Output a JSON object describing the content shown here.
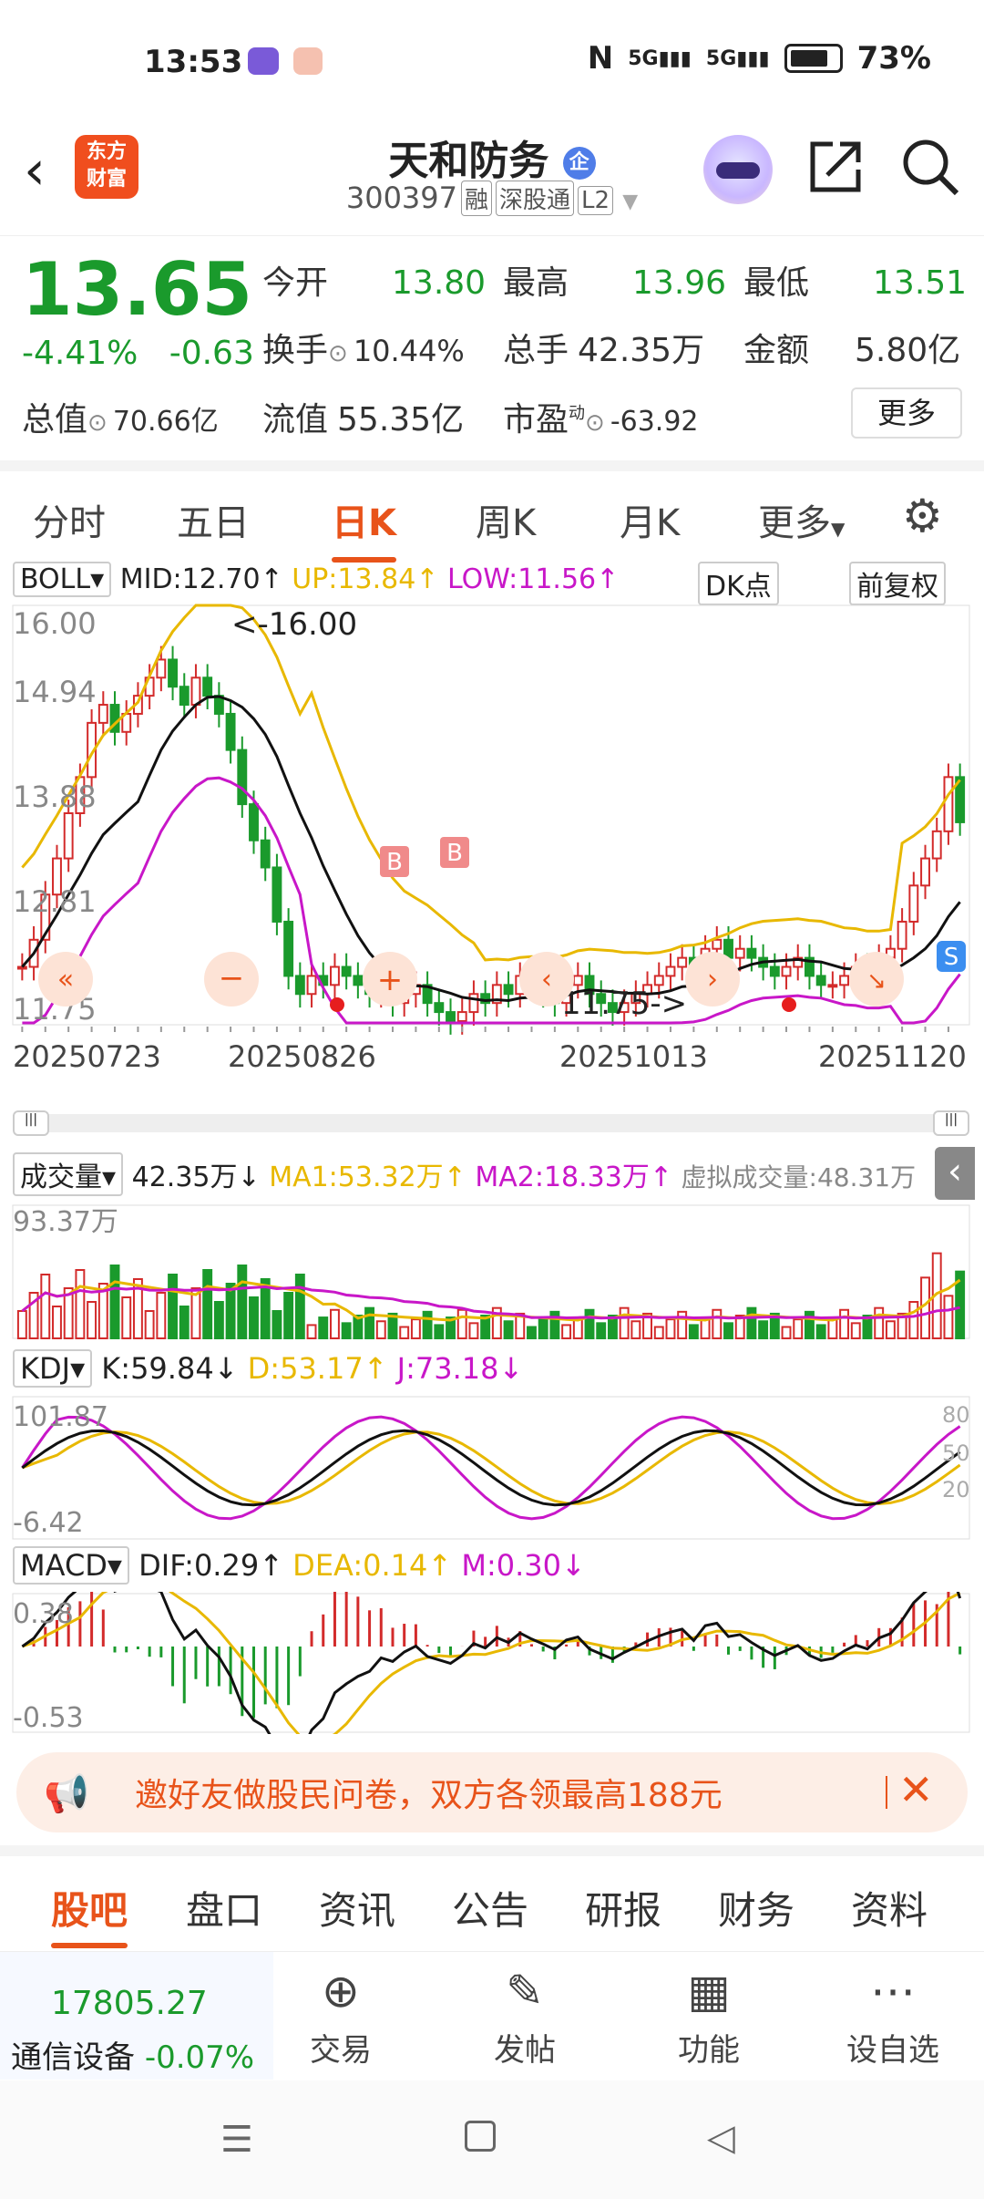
{
  "status": {
    "time": "13:53",
    "signal1": "5G",
    "signal2": "5G",
    "battery": "73%"
  },
  "header": {
    "logo_line1": "东方",
    "logo_line2": "财富",
    "title": "天和防务",
    "badge": "企",
    "code": "300397",
    "tags": [
      "融",
      "深股通",
      "L2"
    ]
  },
  "quote": {
    "price": "13.65",
    "pct": "-4.41%",
    "chg": "-0.63",
    "open_label": "今开",
    "open": "13.80",
    "high_label": "最高",
    "high": "13.96",
    "low_label": "最低",
    "low": "13.51",
    "turnover_label": "换手",
    "turnover": "10.44%",
    "vol_label": "总手",
    "vol": "42.35万",
    "amount_label": "金额",
    "amount": "5.80亿",
    "mcap_label": "总值",
    "mcap": "70.66亿",
    "float_label": "流值",
    "float": "55.35亿",
    "pe_label": "市盈",
    "pe_sup": "动",
    "pe": "-63.92",
    "more": "更多"
  },
  "tabs": [
    "分时",
    "五日",
    "日K",
    "周K",
    "月K",
    "更多"
  ],
  "active_tab": "日K",
  "boll": {
    "name": "BOLL",
    "mid": "MID:12.70↑",
    "up": "UP:13.84↑",
    "low": "LOW:11.56↑",
    "dk": "DK点",
    "fq": "前复权"
  },
  "kchart": {
    "y_labels": [
      "16.00",
      "14.94",
      "13.88",
      "12.81",
      "11.75"
    ],
    "max_label": "<-16.00",
    "min_label": "11.75->",
    "dates": [
      "20250723",
      "20250826",
      "20251013",
      "20251120"
    ],
    "b_marks": [
      "B",
      "B"
    ],
    "s_mark": "S"
  },
  "volume": {
    "name": "成交量",
    "val": "42.35万↓",
    "ma1": "MA1:53.32万↑",
    "ma2": "MA2:18.33万↑",
    "virtual": "虚拟成交量:48.31万",
    "top": "93.37万"
  },
  "kdj": {
    "name": "KDJ",
    "k": "K:59.84↓",
    "d": "D:53.17↑",
    "j": "J:73.18↓",
    "top": "101.87",
    "bottom": "-6.42",
    "r80": "80",
    "r50": "50",
    "r20": "20"
  },
  "macd": {
    "name": "MACD",
    "dif": "DIF:0.29↑",
    "dea": "DEA:0.14↑",
    "m": "M:0.30↓",
    "top": "0.38",
    "bottom": "-0.53"
  },
  "banner": {
    "text": "邀好友做股民问卷，双方各领最高188元"
  },
  "bottom_tabs": [
    "股吧",
    "盘口",
    "资讯",
    "公告",
    "研报",
    "财务",
    "资料"
  ],
  "toolbar": {
    "index_val": "17805.27",
    "index_name": "通信设备",
    "index_pct": "-0.07%",
    "items": [
      "交易",
      "发帖",
      "功能",
      "设自选"
    ]
  },
  "colors": {
    "up": "#d32b2b",
    "down": "#1a9a2c",
    "accent": "#e8531a",
    "yellow": "#e8b800",
    "magenta": "#c817c8"
  }
}
